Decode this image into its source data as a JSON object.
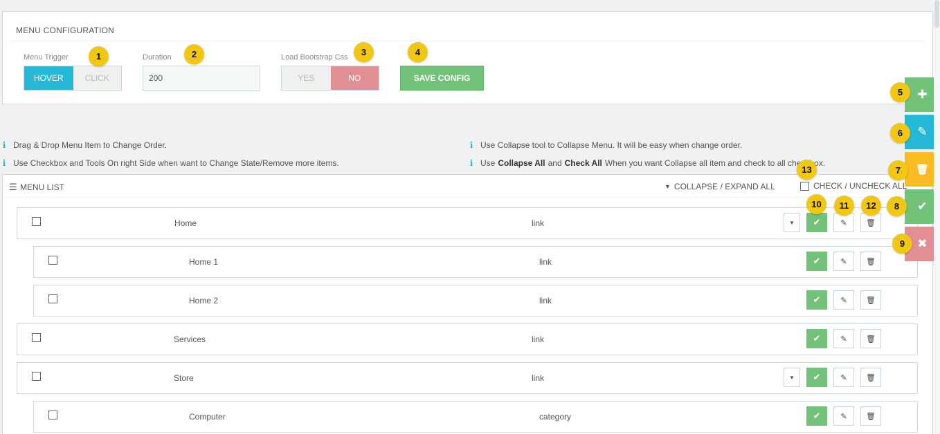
{
  "config": {
    "title": "MENU CONFIGURATION",
    "menu_trigger": {
      "label": "Menu Trigger",
      "options": [
        "HOVER",
        "CLICK"
      ],
      "selected": "HOVER"
    },
    "duration": {
      "label": "Duration",
      "value": "200"
    },
    "bootstrap": {
      "label": "Load Bootstrap Css",
      "options": [
        "YES",
        "NO"
      ],
      "selected": "NO"
    },
    "save_label": "SAVE CONFIG"
  },
  "notes": {
    "n1": "Drag & Drop Menu Item to Change Order.",
    "n2": "Use Checkbox and Tools On right Side when want to Change State/Remove more items.",
    "n3": "Use Collapse tool to Collapse Menu. It will be easy when change order.",
    "n4_pre": "Use",
    "n4_b1": "Collapse All",
    "n4_mid": "and",
    "n4_b2": "Check All",
    "n4_post": "When you want Collapse all item and check to all checkbox."
  },
  "menu": {
    "title": "MENU LIST",
    "collapse_label": "COLLAPSE / EXPAND ALL",
    "check_all_label": "CHECK / UNCHECK ALL",
    "items": [
      {
        "name": "Home",
        "type": "link"
      },
      {
        "name": "Home 1",
        "type": "link"
      },
      {
        "name": "Home 2",
        "type": "link"
      },
      {
        "name": "Services",
        "type": "link"
      },
      {
        "name": "Store",
        "type": "link"
      },
      {
        "name": "Computer",
        "type": "category"
      }
    ]
  },
  "icons": {
    "info": "info-icon",
    "check": "check-icon",
    "edit": "edit-icon",
    "trash": "trash-icon",
    "plus": "plus-icon",
    "close": "close-icon",
    "caret": "caret-down-icon",
    "list": "list-icon"
  },
  "colors": {
    "blue": "#25b9d7",
    "green": "#72c279",
    "yellow": "#fbbb22",
    "red": "#e08f95",
    "marker": "#f2c713"
  },
  "markers": [
    "1",
    "2",
    "3",
    "4",
    "5",
    "6",
    "7",
    "8",
    "9",
    "10",
    "11",
    "12",
    "13"
  ]
}
